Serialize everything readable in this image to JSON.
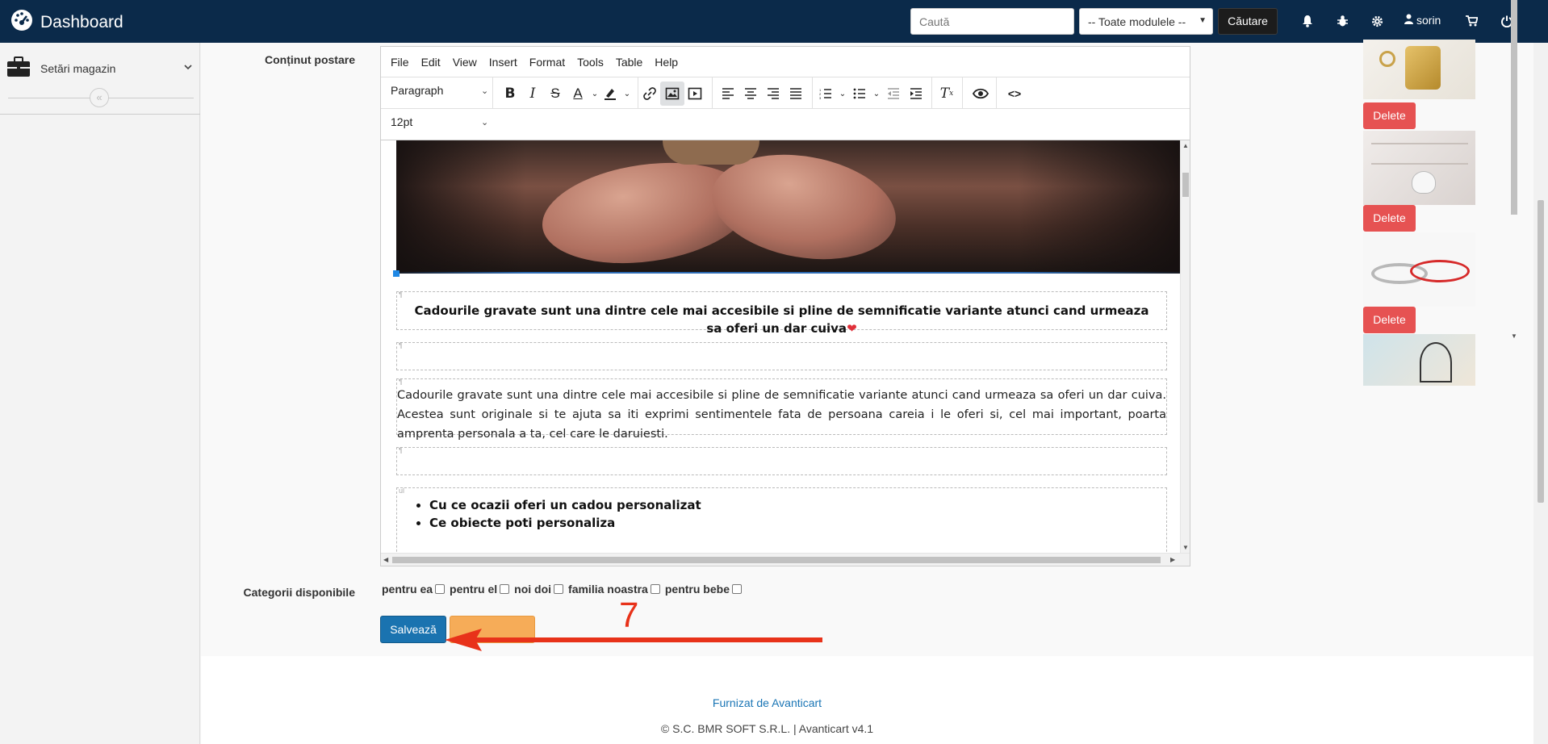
{
  "topbar": {
    "brand": "Dashboard",
    "search_placeholder": "Caută",
    "module_select": "-- Toate modulele --",
    "search_button": "Căutare",
    "user": "sorin",
    "icons": [
      "bell-icon",
      "bug-icon",
      "gear-icon",
      "user-icon",
      "cart-icon",
      "power-icon"
    ]
  },
  "sidebar": {
    "items": [
      {
        "label": "Setări magazin",
        "icon": "briefcase-icon"
      }
    ],
    "collapse_icon": "double-chevron-left-icon"
  },
  "form": {
    "content_label": "Conținut postare",
    "categories_label": "Categorii disponibile",
    "categories": [
      "pentru ea",
      "pentru el",
      "noi doi",
      "familia noastra",
      "pentru bebe"
    ],
    "save_button": "Salvează"
  },
  "editor": {
    "menu": [
      "File",
      "Edit",
      "View",
      "Insert",
      "Format",
      "Tools",
      "Table",
      "Help"
    ],
    "block_format": "Paragraph",
    "font_size": "12pt",
    "heading": "Cadourile gravate sunt una dintre cele mai accesibile si pline de semnificatie variante atunci cand urmeaza sa oferi un dar cuiva",
    "heart": "❤",
    "paragraph": "Cadourile gravate sunt una dintre cele mai accesibile si pline de semnificatie variante atunci cand urmeaza sa oferi un dar cuiva. Acestea sunt originale si te ajuta sa iti exprimi sentimentele fata de persoana careia i le oferi si, cel mai important, poarta amprenta personala a ta, cel care le daruiesti.",
    "bullets": [
      "Cu ce ocazii oferi un cadou personalizat",
      "Ce obiecte poti personaliza"
    ]
  },
  "gallery": {
    "delete_label": "Delete"
  },
  "annotation": {
    "number": "7",
    "color": "#e8321a"
  },
  "footer": {
    "link": "Furnizat de Avanticart",
    "copyright": "© S.C. BMR SOFT S.R.L. | Avanticart v4.1"
  }
}
